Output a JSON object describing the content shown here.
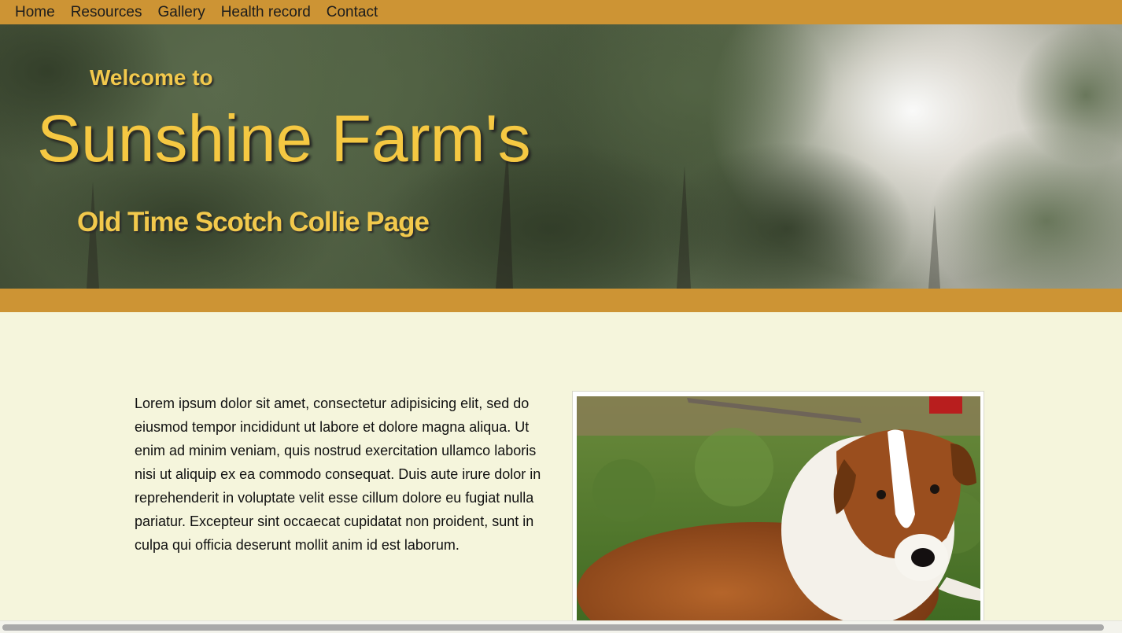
{
  "nav": {
    "items": [
      {
        "label": "Home"
      },
      {
        "label": "Resources"
      },
      {
        "label": "Gallery"
      },
      {
        "label": "Health record"
      },
      {
        "label": "Contact"
      }
    ]
  },
  "hero": {
    "welcome": "Welcome to",
    "title": "Sunshine Farm's",
    "subtitle": "Old Time Scotch Collie Page",
    "background_icon": "forest-canopy-image"
  },
  "main": {
    "intro": "Lorem ipsum dolor sit amet, consectetur adipisicing elit, sed do eiusmod tempor incididunt ut labore et dolore magna aliqua. Ut enim ad minim veniam, quis nostrud exercitation ullamco laboris nisi ut aliquip ex ea commodo consequat. Duis aute irure dolor in reprehenderit in voluptate velit esse cillum dolore eu fugiat nulla pariatur. Excepteur sint occaecat cupidatat non proident, sunt in culpa qui officia deserunt mollit anim id est laborum.",
    "photo_icon": "collie-dog-photo"
  },
  "colors": {
    "accent": "#cd9434",
    "page_bg": "#f5f5dc",
    "title_yellow": "#f5c842"
  }
}
